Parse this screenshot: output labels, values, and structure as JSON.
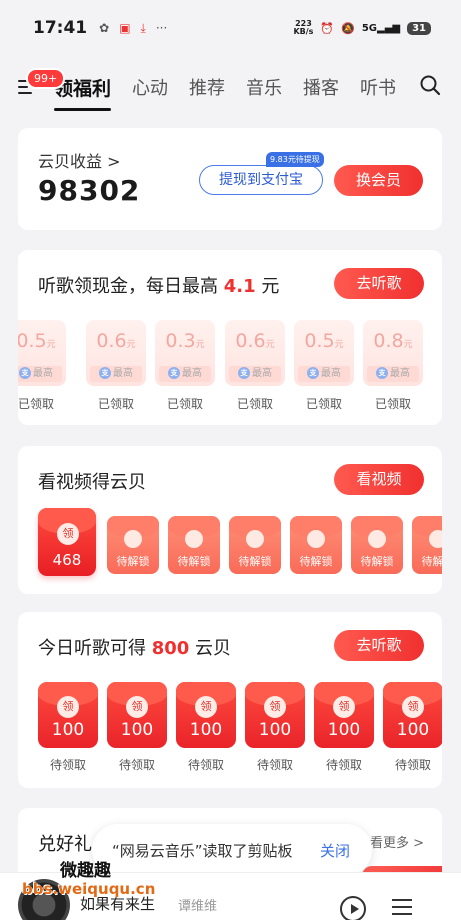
{
  "status": {
    "time": "17:41",
    "net_speed": "223",
    "net_unit": "KB/s",
    "signal": "5G",
    "battery": "31",
    "more": "···"
  },
  "nav": {
    "badge": "99+",
    "tabs": [
      {
        "label": "领福利",
        "active": true
      },
      {
        "label": "心动"
      },
      {
        "label": "推荐"
      },
      {
        "label": "音乐"
      },
      {
        "label": "播客"
      },
      {
        "label": "听书"
      }
    ]
  },
  "cloud_earnings": {
    "label": "云贝收益 >",
    "value": "98302",
    "withdraw_label": "提现到支付宝",
    "withdraw_tag": "9.83元待提现",
    "vip_button": "换会员"
  },
  "listen_cash": {
    "title_prefix": "听歌领现金，每日最高 ",
    "title_highlight": "4.1",
    "title_suffix": " 元",
    "button": "去听歌",
    "coupons": [
      {
        "amount": "0.5",
        "unit": "元",
        "tag": "最高",
        "status": "已领取"
      },
      {
        "amount": "0.6",
        "unit": "元",
        "tag": "最高",
        "status": "已领取"
      },
      {
        "amount": "0.3",
        "unit": "元",
        "tag": "最高",
        "status": "已领取"
      },
      {
        "amount": "0.6",
        "unit": "元",
        "tag": "最高",
        "status": "已领取"
      },
      {
        "amount": "0.5",
        "unit": "元",
        "tag": "最高",
        "status": "已领取"
      },
      {
        "amount": "0.8",
        "unit": "元",
        "tag": "最高",
        "status": "已领取"
      }
    ],
    "alipay_glyph": "支"
  },
  "watch_video": {
    "title": "看视频得云贝",
    "button": "看视频",
    "first": {
      "seal": "领",
      "value": "468"
    },
    "locked_label": "待解锁",
    "locked_count": 6
  },
  "today_listen": {
    "title_prefix": "今日听歌可得 ",
    "title_highlight": "800",
    "title_suffix": " 云贝",
    "button": "去听歌",
    "items": [
      {
        "seal": "领",
        "value": "100",
        "status": "待领取"
      },
      {
        "seal": "领",
        "value": "100",
        "status": "待领取"
      },
      {
        "seal": "领",
        "value": "100",
        "status": "待领取"
      },
      {
        "seal": "领",
        "value": "100",
        "status": "待领取"
      },
      {
        "seal": "领",
        "value": "100",
        "status": "待领取"
      },
      {
        "seal": "领",
        "value": "100",
        "status": "待领取"
      }
    ]
  },
  "exchange": {
    "title": "兑好礼",
    "more": "看更多 >"
  },
  "toast": {
    "message": "“网易云音乐”读取了剪贴板",
    "close": "关闭"
  },
  "player": {
    "song": "如果有来生",
    "artist": "谭维维"
  },
  "watermark": {
    "line1": "微趣趣",
    "line2": "bbs.weiququ.cn"
  }
}
